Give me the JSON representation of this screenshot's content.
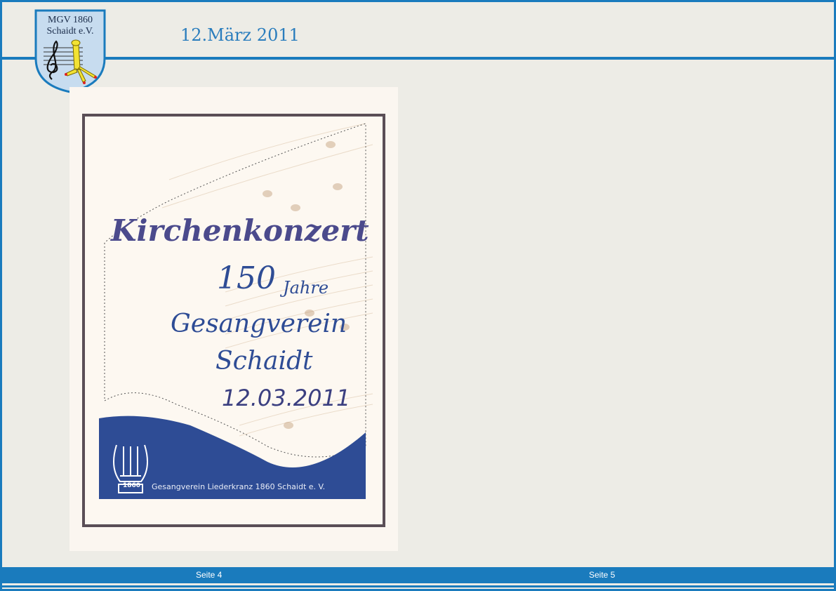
{
  "header": {
    "date": "12.März 2011"
  },
  "logo": {
    "line1": "MGV 1860",
    "line2": "Schaidt e.V."
  },
  "poster": {
    "title": "Kirchenkonzert",
    "years": "150",
    "years_word": "Jahre",
    "club": "Gesangverein",
    "town": "Schaidt",
    "date": "12.03.2011",
    "emblem_year": "1860",
    "footer": "Gesangverein Liederkranz 1860 Schaidt e. V."
  },
  "footer": {
    "left": "Seite 4",
    "right": "Seite 5"
  },
  "colors": {
    "accent": "#1a7bbd",
    "poster_blue": "#2e4c95",
    "title_purple": "#4b4a8c"
  }
}
